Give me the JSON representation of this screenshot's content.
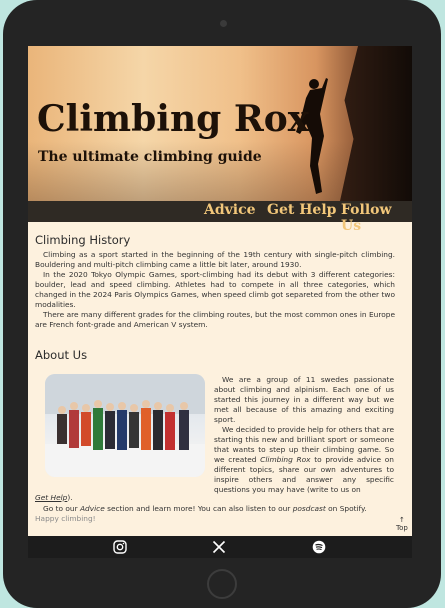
{
  "site": {
    "title": "Climbing Rox",
    "tagline": "The ultimate climbing guide"
  },
  "nav": {
    "advice": "Advice",
    "help": "Get Help",
    "follow": "Follow Us"
  },
  "history": {
    "heading": "Climbing History",
    "p1": "Climbing as a sport started in the beginning of the 19th century with single-pitch climbing. Bouldering and multi-pitch climbing came a little bit later, around 1930.",
    "p2": "In the 2020 Tokyo Olympic Games, sport-climbing had its debut with 3 different categories: boulder, lead and speed climbing. Athletes had to compete in all three categories, which changed in the 2024 Paris Olympics Games, when speed climb got separeted from the other two modalities.",
    "p3": "There are many different grades for the climbing routes, but the most common ones in Europe are French font-grade and American V system."
  },
  "about": {
    "heading": "About Us",
    "p1": "We are a group of 11 swedes passionate about climbing and alpinism. Each one of us started this journey in a different way but we met all because of this amazing and exciting sport.",
    "p2_a": "We decided to provide help for others that are starting this new and brilliant sport or someone that wants to step up their climbing game. So we created ",
    "p2_em": "Climbing Rox",
    "p2_b": " to provide advice on different topics, share our own adventures to inspire others and answer any specific questions you may have (write to us on ",
    "gethelp_link": "Get Help",
    "p2_c": ").",
    "p3_a": "Go to our ",
    "p3_em": "Advice",
    "p3_b": " section and learn more! You can also listen to our ",
    "p3_em2": "posdcast",
    "p3_c": " on Spotify.",
    "p3_d": "Happy climbing!"
  },
  "top": {
    "arrow": "↑",
    "label": "Top"
  },
  "footer": {
    "icons": [
      "instagram-icon",
      "x-icon",
      "spotify-icon"
    ]
  }
}
